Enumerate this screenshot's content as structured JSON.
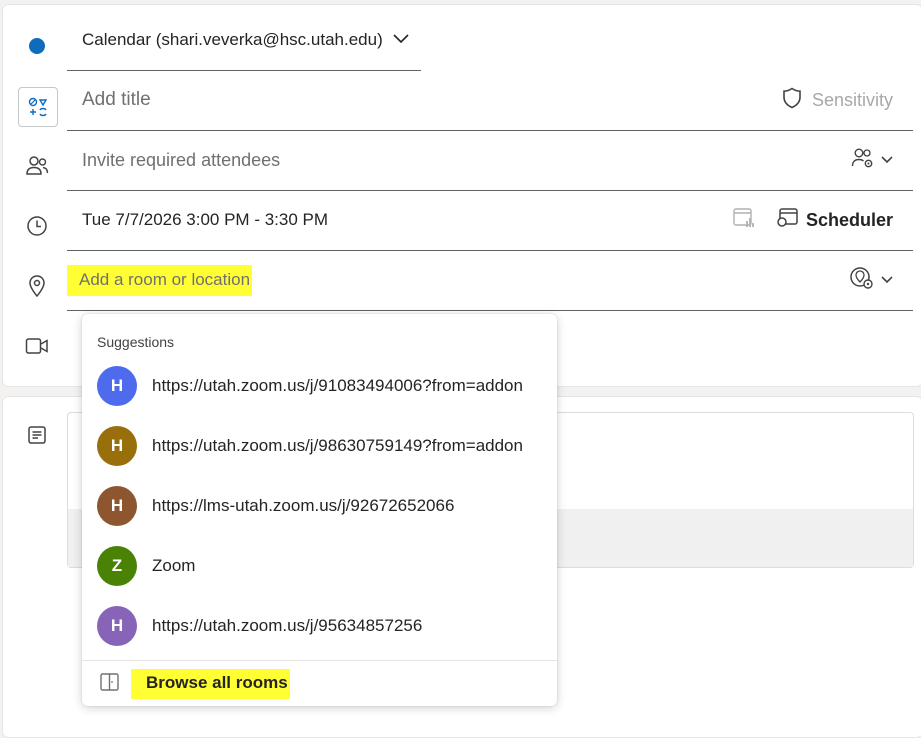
{
  "calendar": {
    "label": "Calendar (shari.veverka@hsc.utah.edu)",
    "dot_color": "#0f6cbd"
  },
  "title": {
    "placeholder": "Add title",
    "sensitivity_label": "Sensitivity"
  },
  "attendees": {
    "placeholder": "Invite required attendees"
  },
  "datetime": {
    "value": "Tue 7/7/2026 3:00 PM - 3:30 PM",
    "scheduler_label": "Scheduler"
  },
  "location": {
    "placeholder": "Add a room or location",
    "highlight_color": "#ffff33"
  },
  "suggestions": {
    "heading": "Suggestions",
    "items": [
      {
        "initial": "H",
        "color": "#4f6bed",
        "text": "https://utah.zoom.us/j/91083494006?from=addon"
      },
      {
        "initial": "H",
        "color": "#986f0b",
        "text": "https://utah.zoom.us/j/98630759149?from=addon"
      },
      {
        "initial": "H",
        "color": "#8e562e",
        "text": "https://lms-utah.zoom.us/j/92672652066"
      },
      {
        "initial": "Z",
        "color": "#498205",
        "text": "Zoom"
      },
      {
        "initial": "H",
        "color": "#8764b8",
        "text": "https://utah.zoom.us/j/95634857256"
      }
    ],
    "browse_label": "Browse all rooms"
  },
  "icons": [
    "calendar-dot-icon",
    "chevron-down-icon",
    "emoji-toggle-icon",
    "shield-icon",
    "people-icon",
    "people-settings-icon",
    "clock-icon",
    "schedule-chart-icon",
    "scheduler-icon",
    "location-pin-icon",
    "location-settings-icon",
    "video-icon",
    "notes-icon",
    "door-icon"
  ]
}
